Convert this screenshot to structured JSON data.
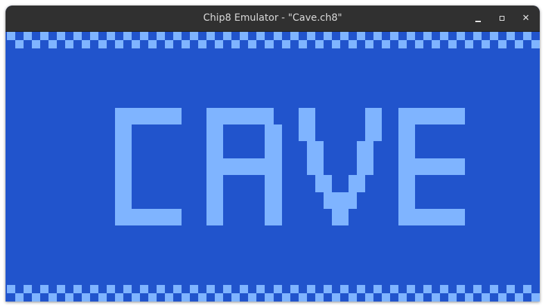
{
  "window": {
    "title": "Chip8 Emulator - \"Cave.ch8\"",
    "controls": {
      "minimize": "minimize",
      "maximize": "maximize",
      "close": "close",
      "close_glyph": "✕"
    }
  },
  "display": {
    "resolution": [
      64,
      32
    ],
    "colors": {
      "off": "#2154cc",
      "on": "#7fb4ff"
    },
    "rows": [
      "1010101010101010101010101010101010101010101010101010101010101010",
      "0101010101010101010101010101010101010101010101010101010101010101",
      "0000000000000000000000000000000000000000000000000000000000000000",
      "0000000000000000000000000000000000000000000000000000000000000000",
      "0000000000000000000000000000000000000000000000000000000000000000",
      "0000000000000000000000000000000000000000000000000000000000000000",
      "0000000000000000000000000000000000000000000000000000000000000000",
      "0000000000000000000000000000000000000000000000000000000000000000",
      "0000000000000000000000000000000000000000000000000000000000000000",
      "0000000000000111111110001111111100011000000110011111111000000000",
      "0000000000000111111110001111111100011000000110011111111000000000",
      "0000000000000110000000001100000110011000000110011000000000000000",
      "0000000000000110000000001100000110011000000110011000000000000000",
      "0000000000000110000000001100000110001100001100011000000000000000",
      "0000000000000110000000001100000110001100001100011000000000000000",
      "0000000000000110000000001111111110001100001100011111111000000000",
      "0000000000000110000000001111111110001100001100011111111000000000",
      "0000000000000110000000001100000110000110011000011000000000000000",
      "0000000000000110000000001100000110000110011000011000000000000000",
      "0000000000000110000000001100000110000011110000011000000000000000",
      "0000000000000110000000001100000110000011110000011000000000000000",
      "0000000000000111111110001100000110000001100000011111111000000000",
      "0000000000000111111110001100000110000001100000011111111000000000",
      "0000000000000000000000000000000000000000000000000000000000000000",
      "0000000000000000000000000000000000000000000000000000000000000000",
      "0000000000000000000000000000000000000000000000000000000000000000",
      "0000000000000000000000000000000000000000000000000000000000000000",
      "0000000000000000000000000000000000000000000000000000000000000000",
      "0000000000000000000000000000000000000000000000000000000000000000",
      "0000000000000000000000000000000000000000000000000000000000000000",
      "1010101010101010101010101010101010101010101010101010101010101010",
      "0101010101010101010101010101010101010101010101010101010101010101"
    ]
  }
}
